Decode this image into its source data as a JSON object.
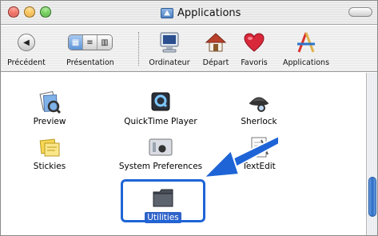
{
  "window": {
    "title": "Applications"
  },
  "toolbar": {
    "back_label": "Précédent",
    "view_label": "Présentation",
    "computer_label": "Ordinateur",
    "home_label": "Départ",
    "favorites_label": "Favoris",
    "applications_label": "Applications"
  },
  "files": [
    {
      "name": "Preview",
      "icon": "preview-icon"
    },
    {
      "name": "QuickTime Player",
      "icon": "quicktime-icon"
    },
    {
      "name": "Sherlock",
      "icon": "sherlock-icon"
    },
    {
      "name": "Stickies",
      "icon": "stickies-icon"
    },
    {
      "name": "System Preferences",
      "icon": "system-preferences-icon"
    },
    {
      "name": "TextEdit",
      "icon": "textedit-icon"
    },
    {
      "name": "Utilities",
      "icon": "folder-icon",
      "selected": true
    }
  ],
  "colors": {
    "highlight": "#1e64d6",
    "selection": "#2f63c9"
  }
}
